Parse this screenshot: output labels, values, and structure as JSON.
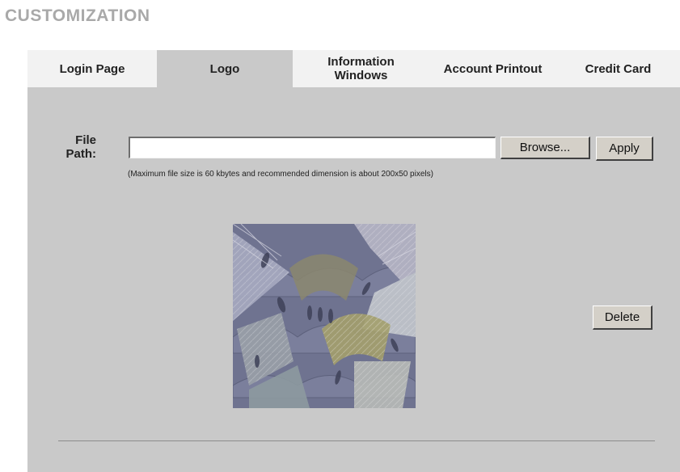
{
  "page": {
    "title": "CUSTOMIZATION"
  },
  "tabs": [
    {
      "label": "Login Page",
      "active": false
    },
    {
      "label": "Logo",
      "active": true
    },
    {
      "label": "Information Windows",
      "active": false
    },
    {
      "label": "Account Printout",
      "active": false
    },
    {
      "label": "Credit Card",
      "active": false
    }
  ],
  "logo_form": {
    "file_label": "File Path:",
    "file_value": "",
    "browse_label": "Browse...",
    "apply_label": "Apply",
    "hint": "(Maximum file size is 60 kbytes and recommended dimension is about 200x50 pixels)",
    "delete_label": "Delete"
  },
  "colors": {
    "title": "#a9a9a9",
    "tab_inactive": "#f2f2f2",
    "tab_active": "#c9c9c9",
    "panel": "#c9c9c9",
    "button_face": "#d4d0c8"
  },
  "icons": {
    "logo_preview": "fan-pattern-image"
  }
}
